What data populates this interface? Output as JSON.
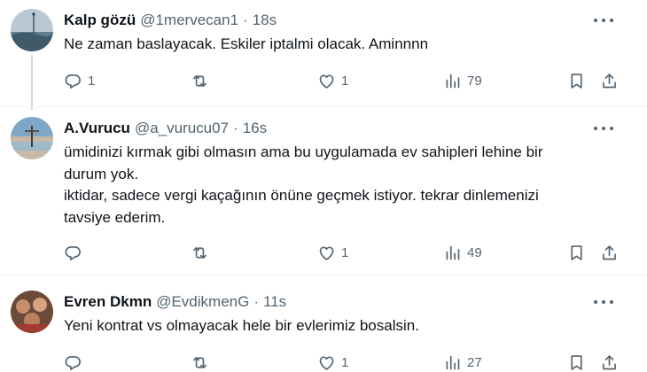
{
  "tweets": [
    {
      "name": "Kalp gözü",
      "handle": "@1mervecan1",
      "dot": "·",
      "time": "18s",
      "lines": [
        "Ne zaman baslayacak. Eskiler iptalmi olacak. Aminnnn"
      ],
      "replies": "1",
      "retweets": "",
      "likes": "1",
      "views": "79"
    },
    {
      "name": "A.Vurucu",
      "handle": "@a_vurucu07",
      "dot": "·",
      "time": "16s",
      "lines": [
        "ümidinizi kırmak gibi olmasın ama bu uygulamada ev sahipleri lehine bir",
        "durum yok.",
        "iktidar, sadece vergi kaçağının önüne geçmek istiyor. tekrar dinlemenizi",
        "tavsiye ederim."
      ],
      "replies": "",
      "retweets": "",
      "likes": "1",
      "views": "49"
    },
    {
      "name": "Evren Dkmn",
      "handle": "@EvdikmenG",
      "dot": "·",
      "time": "11s",
      "lines": [
        "Yeni kontrat vs olmayacak hele bir evlerimiz bosalsin."
      ],
      "replies": "",
      "retweets": "",
      "likes": "1",
      "views": "27"
    }
  ]
}
